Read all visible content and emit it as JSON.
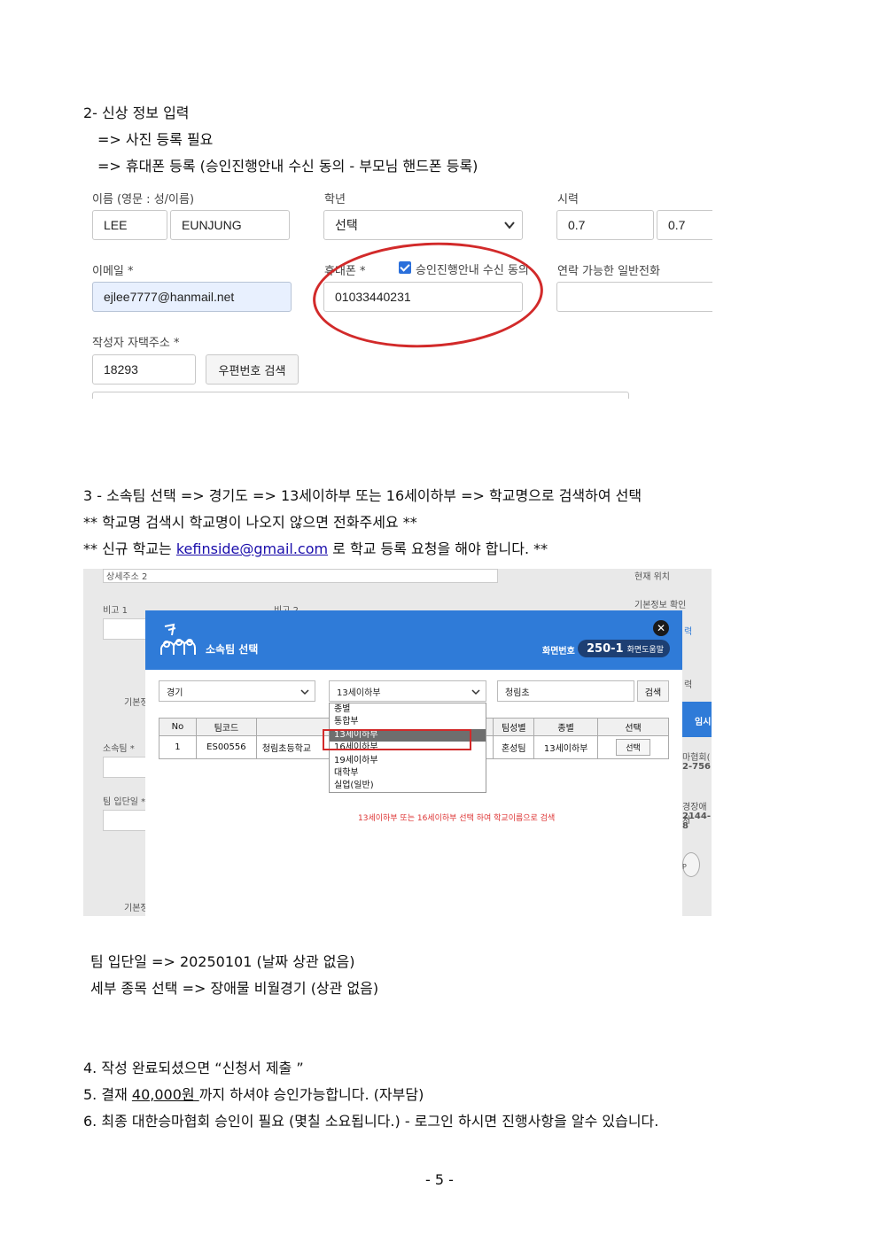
{
  "section2": {
    "title": "2- 신상 정보 입력",
    "sub1": "=> 사진 등록 필요",
    "sub2": "=> 휴대폰 등록 (승인진행안내 수신 동의 - 부모님 핸드폰 등록)"
  },
  "form": {
    "name_label": "이름 (영문 : 성/이름)",
    "last_name": "LEE",
    "first_name": "EUNJUNG",
    "grade_label": "학년",
    "grade_value": "선택",
    "vision_label": "시력",
    "vision_left": "0.7",
    "vision_right": "0.7",
    "email_label": "이메일 *",
    "email_value": "ejlee7777@hanmail.net",
    "phone_label": "휴대폰 *",
    "consent_label": "승인진행안내 수신 동의",
    "phone_value": "01033440231",
    "landline_label": "연락 가능한 일반전화",
    "address_label": "작성자 자택주소 *",
    "postcode": "18293",
    "postcode_button": "우편번호 검색"
  },
  "section3": {
    "line1": "3 - 소속팀 선택 =>  경기도 => 13세이하부 또는 16세이하부 => 학교명으로 검색하여 선택",
    "line2": "** 학교명 검색시 학교명이 나오지 않으면 전화주세요 **",
    "line3_pre": "** 신규 학교는 ",
    "email_link": "kefinside@gmail.com",
    "line3_post": " 로 학교 등록 요청을 해야 합니다. **"
  },
  "background": {
    "addr2": "상세주소 2",
    "note1": "비고 1",
    "note2": "비고 2",
    "basic": "기본정",
    "team": "소속팀 *",
    "joindate": "팀 입단일 *",
    "basic2": "기본정",
    "loc": "현재 위치",
    "loc1": "기본정보 확인",
    "side1": "력",
    "side2": "력",
    "assoc": "마협회(",
    "phone1": "2-756",
    "venue": "경장애처",
    "phone2": "2144-8",
    "temp": "임시",
    "top": "P"
  },
  "modal": {
    "title": "소속팀 선택",
    "screen_label": "화면번호",
    "screen_num": "250-1",
    "screen_help": "화면도움말",
    "close": "✕",
    "region": "경기",
    "division": "13세이하부",
    "school_search": "청림초",
    "search_button": "검색",
    "headers": [
      "No",
      "팀코드",
      "",
      "팀성별",
      "종별",
      "선택"
    ],
    "row": {
      "no": "1",
      "code": "ES00556",
      "name": "청림초등학교",
      "gender": "혼성팀",
      "division": "13세이하부",
      "select": "선택"
    },
    "dropdown": [
      "종별",
      "통합부",
      "13세이하부",
      "16세이하부",
      "19세이하부",
      "대학부",
      "실업(일반)"
    ],
    "hint": "13세이하부 또는 16세이하부 선택 하여 학교이름으로 검색"
  },
  "after": {
    "line1": "팀 입단일 => 20250101 (날짜 상관 없음)",
    "line2": "세부 종목 선택 => 장애물 비월경기 (상관 없음)"
  },
  "steps": {
    "step4": "4. 작성 완료되셨으면 “신청서 제출 ”",
    "step5_pre": "5. 결재 ",
    "step5_amount": "40,000원 ",
    "step5_post": "까지 하셔야 승인가능합니다. (자부담)",
    "step6": "6. 최종 대한승마협회 승인이 필요 (몇칠 소요됩니다.) - 로그인 하시면 진행사항을 알수 있습니다."
  },
  "page_number": "- 5 -"
}
